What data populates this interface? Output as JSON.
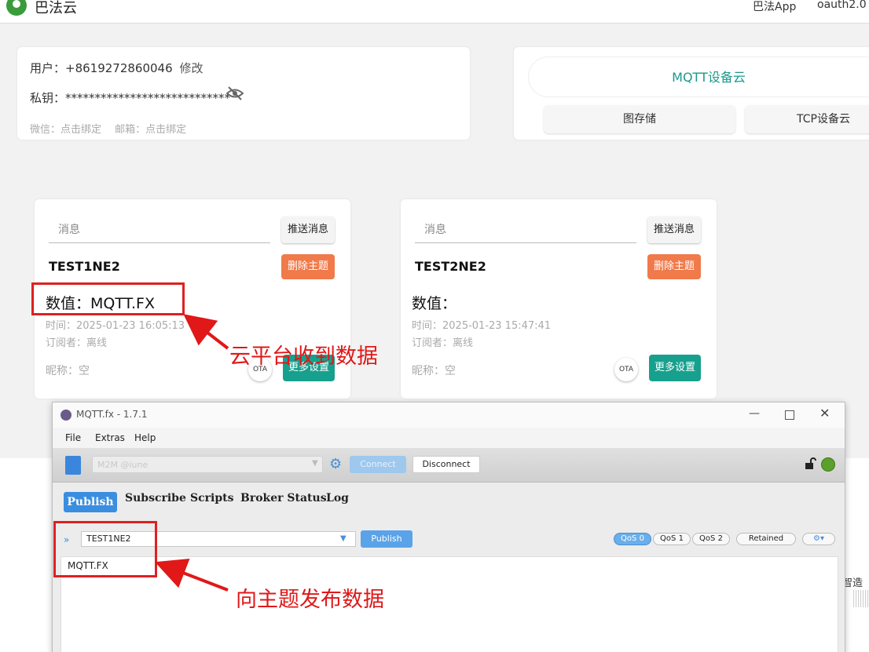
{
  "header": {
    "brand": "巴法云",
    "nav_app": "巴法App",
    "nav_oauth": "oauth2.0"
  },
  "user": {
    "user_label": "用户：",
    "user_value": "+8619272860046",
    "edit_label": "修改",
    "key_label": "私钥：",
    "key_mask": "****************************",
    "bind_text": "微信：点击绑定　 邮箱：点击绑定"
  },
  "services": {
    "mqtt": "MQTT设备云",
    "image_storage": "图存储",
    "tcp": "TCP设备云"
  },
  "topics": [
    {
      "msg_placeholder": "消息",
      "push_label": "推送消息",
      "name": "TEST1NE2",
      "delete_label": "删除主题",
      "value": "数值：MQTT.FX",
      "time": "时间：2025-01-23 16:05:13",
      "subscribers": "订阅者：离线",
      "nickname": "昵称：空",
      "ota_label": "OTA",
      "more_label": "更多设置"
    },
    {
      "msg_placeholder": "消息",
      "push_label": "推送消息",
      "name": "TEST2NE2",
      "delete_label": "删除主题",
      "value": "数值：",
      "time": "时间：2025-01-23 15:47:41",
      "subscribers": "订阅者：离线",
      "nickname": "昵称：空",
      "ota_label": "OTA",
      "more_label": "更多设置"
    }
  ],
  "annotations": {
    "cloud_received": "云平台收到数据",
    "publish_to_topic": "向主题发布数据"
  },
  "mqttfx": {
    "title": "MQTT.fx - 1.7.1",
    "menu": [
      "File",
      "Extras",
      "Help"
    ],
    "profile": "M2M @iune",
    "connect_label": "Connect",
    "disconnect_label": "Disconnect",
    "tabs": [
      "Publish",
      "Subscribe",
      "Scripts",
      "Broker Status",
      "Log"
    ],
    "topic_value": "TEST1NE2",
    "publish_label": "Publish",
    "qos": [
      "QoS 0",
      "QoS 1",
      "QoS 2"
    ],
    "retained_label": "Retained",
    "payload": "MQTT.FX",
    "status_color": "#5aa02c"
  },
  "side_text": "智造"
}
